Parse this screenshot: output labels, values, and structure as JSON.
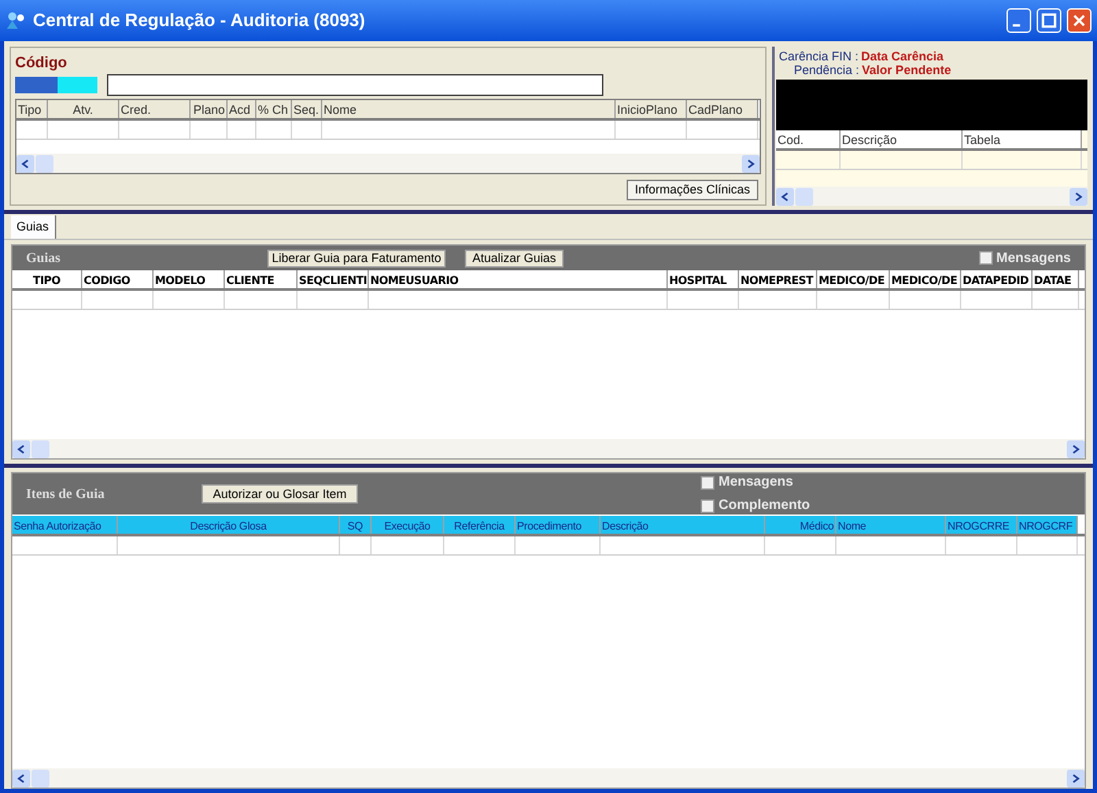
{
  "window": {
    "title": "Central de Regulação - Auditoria (8093)"
  },
  "top": {
    "code_label": "Código",
    "columns": [
      "Tipo",
      "Atv.",
      "Cred.",
      "Plano",
      "Acd",
      "% Ch",
      "Seq.",
      "Nome",
      "InicioPlano",
      "CadPlano"
    ],
    "button": "Informações Clínicas"
  },
  "info": {
    "carencia_label": "Carência FIN :",
    "carencia_value": "Data Carência",
    "pendencia_label": "Pendência :",
    "pendencia_value": "Valor Pendente",
    "columns": [
      "Cod.",
      "Descrição",
      "Tabela"
    ]
  },
  "tabs": [
    {
      "label": "Guias",
      "selected": true
    }
  ],
  "guias": {
    "title": "Guias",
    "buttons": [
      "Liberar Guia  para Faturamento",
      "Atualizar Guias"
    ],
    "checkboxes": [
      {
        "label": "Mensagens",
        "checked": false
      }
    ],
    "columns": [
      "TIPO",
      "CODIGO",
      "MODELO",
      "CLIENTE",
      "SEQCLIENTI",
      "NOMEUSUARIO",
      "HOSPITAL",
      "NOMEPREST",
      "MEDICO/DE",
      "MEDICO/DE",
      "DATAPEDID",
      "DATAE"
    ]
  },
  "itens": {
    "title": "Itens de Guia",
    "buttons": [
      "Autorizar ou Glosar Item"
    ],
    "checkboxes": [
      {
        "label": "Mensagens",
        "checked": false
      },
      {
        "label": "Complemento",
        "checked": false
      }
    ],
    "columns": [
      "Senha Autorização",
      "Descrição Glosa",
      "SQ",
      "Execução",
      "Referência",
      "Procedimento",
      "Descrição",
      "Médico",
      "Nome",
      "NROGCRRE",
      "NROGCRF"
    ]
  }
}
